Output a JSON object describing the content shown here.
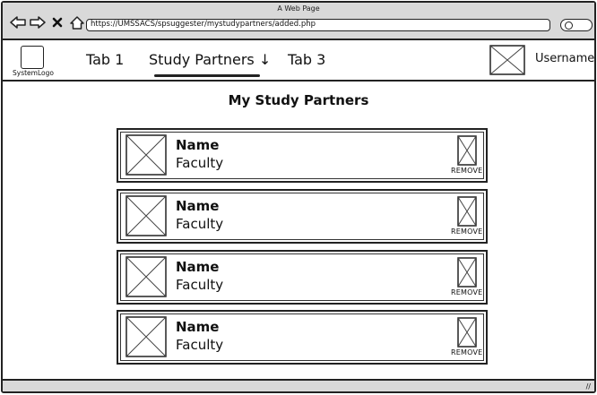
{
  "browser": {
    "window_title": "A Web Page",
    "url": "https://UMSSACS/spsuggester/mystudypartners/added.php",
    "nav_icons": [
      "back-arrow-icon",
      "forward-arrow-icon",
      "close-icon",
      "home-icon"
    ],
    "search_icon": "search-icon"
  },
  "header": {
    "logo_label": "SystemLogo",
    "tabs": [
      {
        "label": "Tab 1"
      },
      {
        "label": "Study Partners ↓"
      },
      {
        "label": "Tab 3"
      }
    ],
    "username": "Username"
  },
  "main": {
    "title": "My Study Partners",
    "partners": [
      {
        "name": "Name",
        "faculty": "Faculty",
        "remove_label": "REMOVE"
      },
      {
        "name": "Name",
        "faculty": "Faculty",
        "remove_label": "REMOVE"
      },
      {
        "name": "Name",
        "faculty": "Faculty",
        "remove_label": "REMOVE"
      },
      {
        "name": "Name",
        "faculty": "Faculty",
        "remove_label": "REMOVE"
      }
    ]
  }
}
